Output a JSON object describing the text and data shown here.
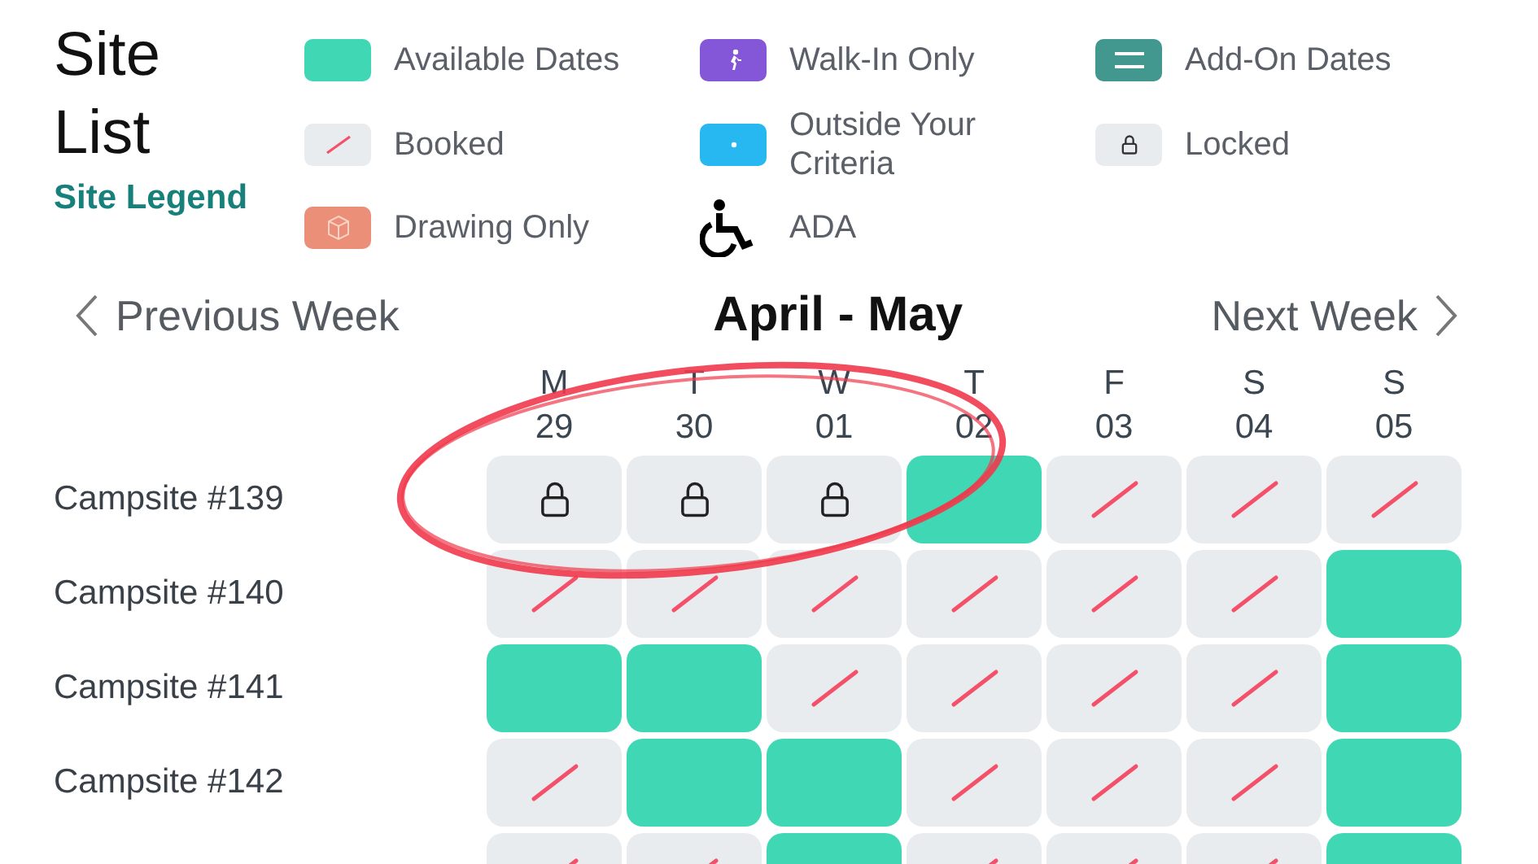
{
  "title": "Site List",
  "legend_link": "Site Legend",
  "legend": [
    {
      "kind": "available",
      "label": "Available Dates"
    },
    {
      "kind": "walkin",
      "label": "Walk-In Only"
    },
    {
      "kind": "addon",
      "label": "Add-On Dates"
    },
    {
      "kind": "booked",
      "label": "Booked"
    },
    {
      "kind": "outside",
      "label": "Outside Your Criteria"
    },
    {
      "kind": "locked",
      "label": "Locked"
    },
    {
      "kind": "drawing",
      "label": "Drawing Only"
    },
    {
      "kind": "ada",
      "label": "ADA"
    }
  ],
  "nav": {
    "previous": "Previous Week",
    "title": "April - May",
    "next": "Next Week"
  },
  "days": [
    {
      "weekday": "M",
      "date": "29"
    },
    {
      "weekday": "T",
      "date": "30"
    },
    {
      "weekday": "W",
      "date": "01"
    },
    {
      "weekday": "T",
      "date": "02"
    },
    {
      "weekday": "F",
      "date": "03"
    },
    {
      "weekday": "S",
      "date": "04"
    },
    {
      "weekday": "S",
      "date": "05"
    }
  ],
  "sites": [
    {
      "name": "Campsite #139",
      "cells": [
        {
          "kind": "locked"
        },
        {
          "kind": "locked"
        },
        {
          "kind": "locked"
        },
        {
          "kind": "available"
        },
        {
          "kind": "booked"
        },
        {
          "kind": "booked"
        },
        {
          "kind": "booked"
        }
      ]
    },
    {
      "name": "Campsite #140",
      "cells": [
        {
          "kind": "booked"
        },
        {
          "kind": "booked"
        },
        {
          "kind": "booked"
        },
        {
          "kind": "booked"
        },
        {
          "kind": "booked"
        },
        {
          "kind": "booked"
        },
        {
          "kind": "available"
        }
      ]
    },
    {
      "name": "Campsite #141",
      "cells": [
        {
          "kind": "available"
        },
        {
          "kind": "available"
        },
        {
          "kind": "booked"
        },
        {
          "kind": "booked"
        },
        {
          "kind": "booked"
        },
        {
          "kind": "booked"
        },
        {
          "kind": "available"
        }
      ]
    },
    {
      "name": "Campsite #142",
      "cells": [
        {
          "kind": "booked"
        },
        {
          "kind": "available"
        },
        {
          "kind": "available"
        },
        {
          "kind": "booked"
        },
        {
          "kind": "booked"
        },
        {
          "kind": "booked"
        },
        {
          "kind": "available"
        }
      ]
    },
    {
      "cells": [
        {
          "kind": "booked"
        },
        {
          "kind": "booked"
        },
        {
          "kind": "available"
        },
        {
          "kind": "booked"
        },
        {
          "kind": "booked"
        },
        {
          "kind": "booked"
        },
        {
          "kind": "available"
        }
      ]
    }
  ]
}
